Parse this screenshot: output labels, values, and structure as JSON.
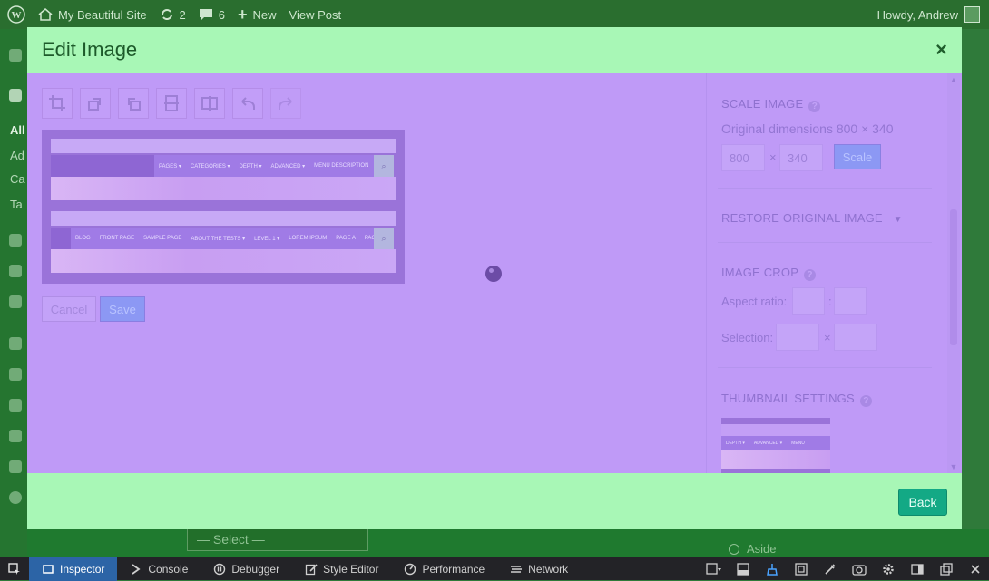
{
  "admin_bar": {
    "site_name": "My Beautiful Site",
    "updates_count": "2",
    "comments_count": "6",
    "new_label": "New",
    "view_post_label": "View Post",
    "howdy": "Howdy, Andrew"
  },
  "backdrop": {
    "menu_labels": [
      "All",
      "Ad",
      "Ca",
      "Ta"
    ],
    "select_placeholder": "— Select —",
    "aside_label": "Aside"
  },
  "modal": {
    "title": "Edit Image",
    "close_symbol": "×",
    "back_label": "Back",
    "toolbar": [
      "crop-icon",
      "rotate-left-icon",
      "rotate-right-icon",
      "flip-vertical-icon",
      "flip-horizontal-icon",
      "undo-icon",
      "redo-icon"
    ],
    "preview": {
      "nav1": [
        "PAGES ▾",
        "CATEGORIES ▾",
        "DEPTH ▾",
        "ADVANCED ▾",
        "MENU DESCRIPTION"
      ],
      "nav2": [
        "BLOG",
        "FRONT PAGE",
        "SAMPLE PAGE",
        "ABOUT THE TESTS ▾",
        "LEVEL 1 ▾",
        "LOREM IPSUM",
        "PAGE A",
        "PAGE B"
      ]
    },
    "cancel_label": "Cancel",
    "save_label": "Save",
    "settings": {
      "scale_title": "SCALE IMAGE",
      "original_dimensions": "Original dimensions 800 × 340",
      "width_value": "800",
      "times": "×",
      "height_value": "340",
      "scale_label": "Scale",
      "restore_title": "RESTORE ORIGINAL IMAGE",
      "crop_title": "IMAGE CROP",
      "aspect_label": "Aspect ratio:",
      "colon": ":",
      "selection_label": "Selection:",
      "thumbnail_title": "THUMBNAIL SETTINGS",
      "thumb_nav": [
        "DEPTH ▾",
        "ADVANCED ▾",
        "MENU"
      ]
    }
  },
  "devtools": {
    "tabs": [
      "Inspector",
      "Console",
      "Debugger",
      "Style Editor",
      "Performance",
      "Network"
    ],
    "active_tab": "Inspector"
  }
}
